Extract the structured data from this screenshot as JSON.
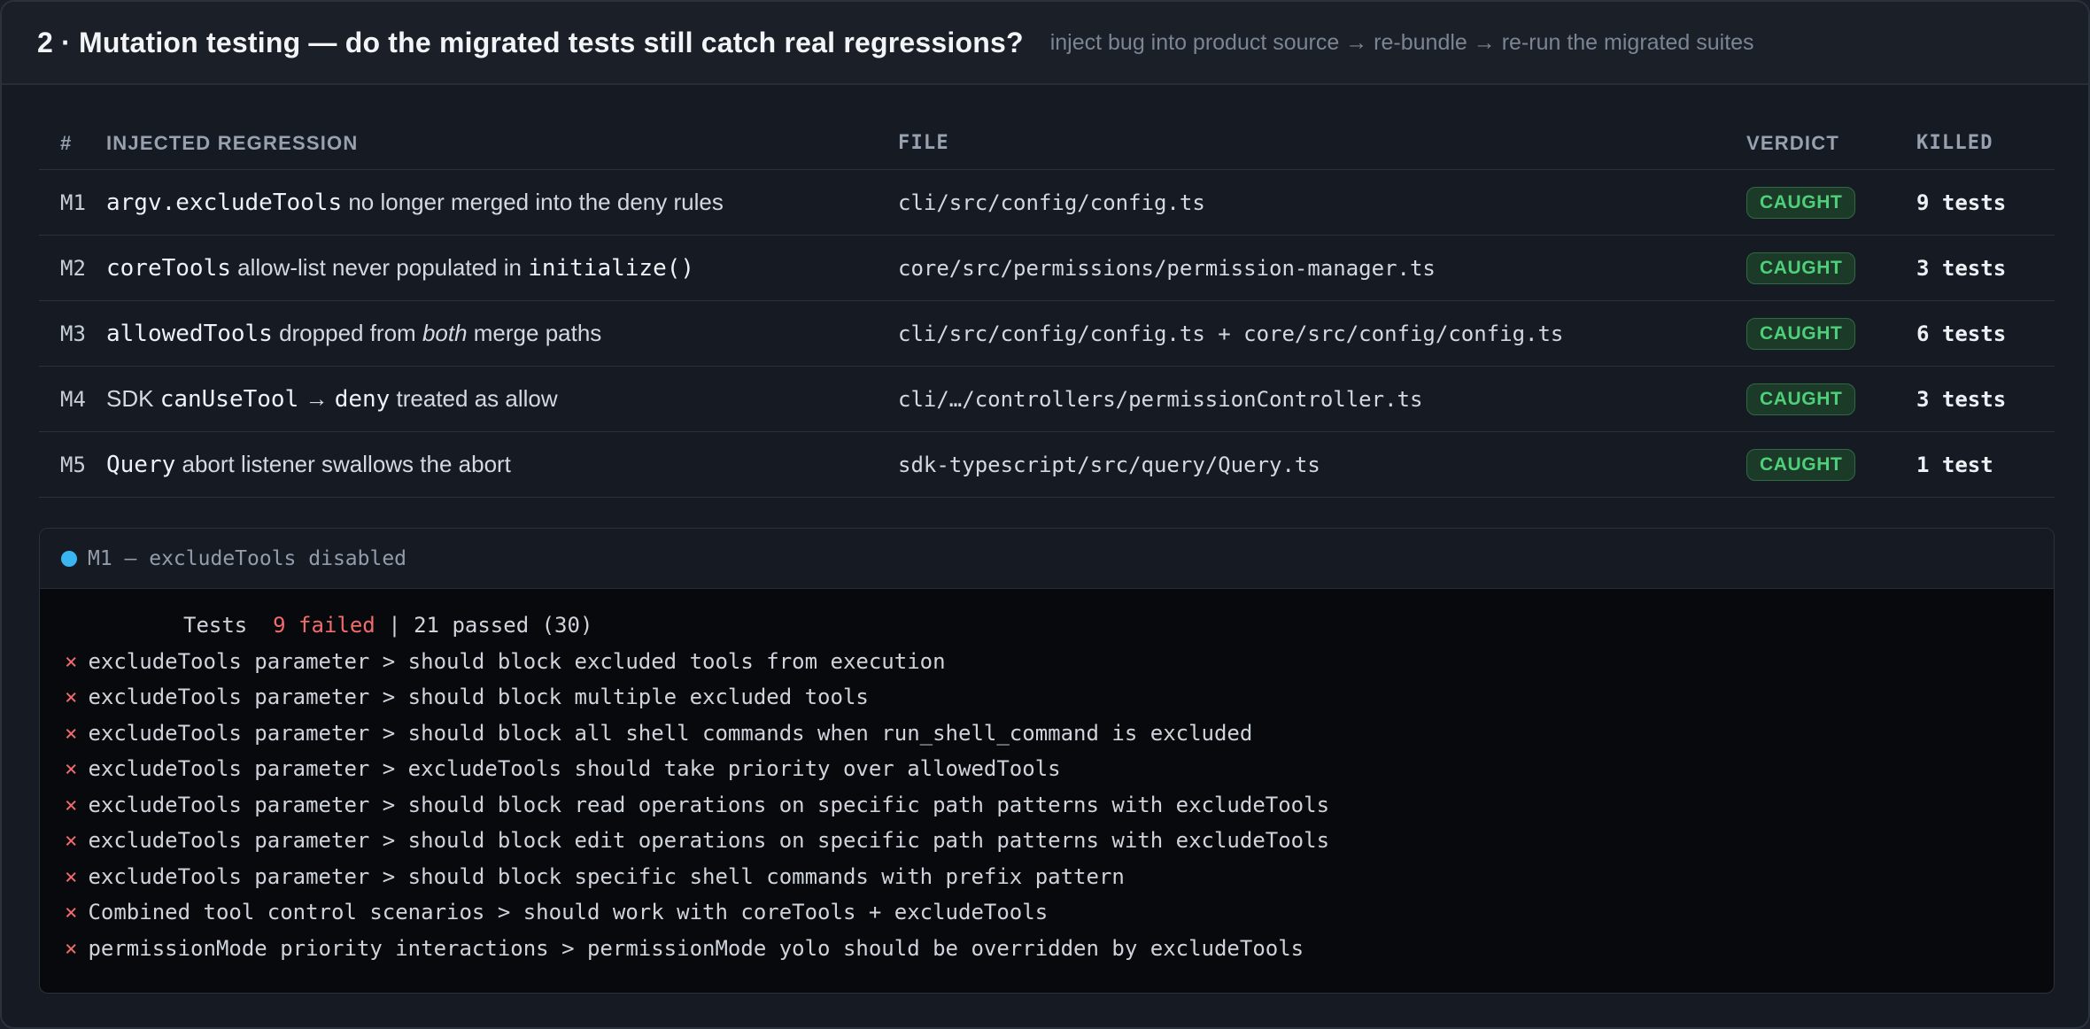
{
  "header": {
    "title": "2 · Mutation testing — do the migrated tests still catch real regressions?",
    "subtitle": "inject bug into product source → re-bundle → re-run the migrated suites"
  },
  "table": {
    "columns": {
      "num": "#",
      "desc": "INJECTED REGRESSION",
      "file": "FILE",
      "verdict": "VERDICT",
      "killed": "KILLED"
    },
    "rows": [
      {
        "id": "M1",
        "desc": [
          {
            "t": "argv.excludeTools",
            "code": true
          },
          {
            "t": " no longer merged into the deny rules"
          }
        ],
        "file": "cli/src/config/config.ts",
        "verdict": "CAUGHT",
        "killed": "9 tests"
      },
      {
        "id": "M2",
        "desc": [
          {
            "t": "coreTools",
            "code": true
          },
          {
            "t": " allow-list never populated in "
          },
          {
            "t": "initialize()",
            "code": true
          }
        ],
        "file": "core/src/permissions/permission-manager.ts",
        "verdict": "CAUGHT",
        "killed": "3 tests"
      },
      {
        "id": "M3",
        "desc": [
          {
            "t": "allowedTools",
            "code": true
          },
          {
            "t": " dropped from "
          },
          {
            "t": "both",
            "italic": true
          },
          {
            "t": " merge paths"
          }
        ],
        "file": "cli/src/config/config.ts + core/src/config/config.ts",
        "verdict": "CAUGHT",
        "killed": "6 tests"
      },
      {
        "id": "M4",
        "desc": [
          {
            "t": "SDK "
          },
          {
            "t": "canUseTool",
            "code": true
          },
          {
            "t": " → "
          },
          {
            "t": "deny",
            "code": true
          },
          {
            "t": " treated as allow"
          }
        ],
        "file": "cli/…/controllers/permissionController.ts",
        "verdict": "CAUGHT",
        "killed": "3 tests"
      },
      {
        "id": "M5",
        "desc": [
          {
            "t": "Query",
            "code": true
          },
          {
            "t": " abort listener swallows the abort"
          }
        ],
        "file": "sdk-typescript/src/query/Query.ts",
        "verdict": "CAUGHT",
        "killed": "1 test"
      }
    ]
  },
  "panel": {
    "title": "M1 — excludeTools disabled",
    "summary": {
      "prefix": "Tests  ",
      "failed": "9 failed",
      "rest": " | 21 passed (30)"
    },
    "fail_mark": "×",
    "failures": [
      "excludeTools parameter > should block excluded tools from execution",
      "excludeTools parameter > should block multiple excluded tools",
      "excludeTools parameter > should block all shell commands when run_shell_command is excluded",
      "excludeTools parameter > excludeTools should take priority over allowedTools",
      "excludeTools parameter > should block read operations on specific path patterns with excludeTools",
      "excludeTools parameter > should block edit operations on specific path patterns with excludeTools",
      "excludeTools parameter > should block specific shell commands with prefix pattern",
      "Combined tool control scenarios > should work with coreTools + excludeTools",
      "permissionMode priority interactions > permissionMode yolo should be overridden by excludeTools"
    ]
  },
  "colors": {
    "caught": "#4ed07a",
    "failed": "#f26b6b",
    "dot": "#39b6f2"
  }
}
